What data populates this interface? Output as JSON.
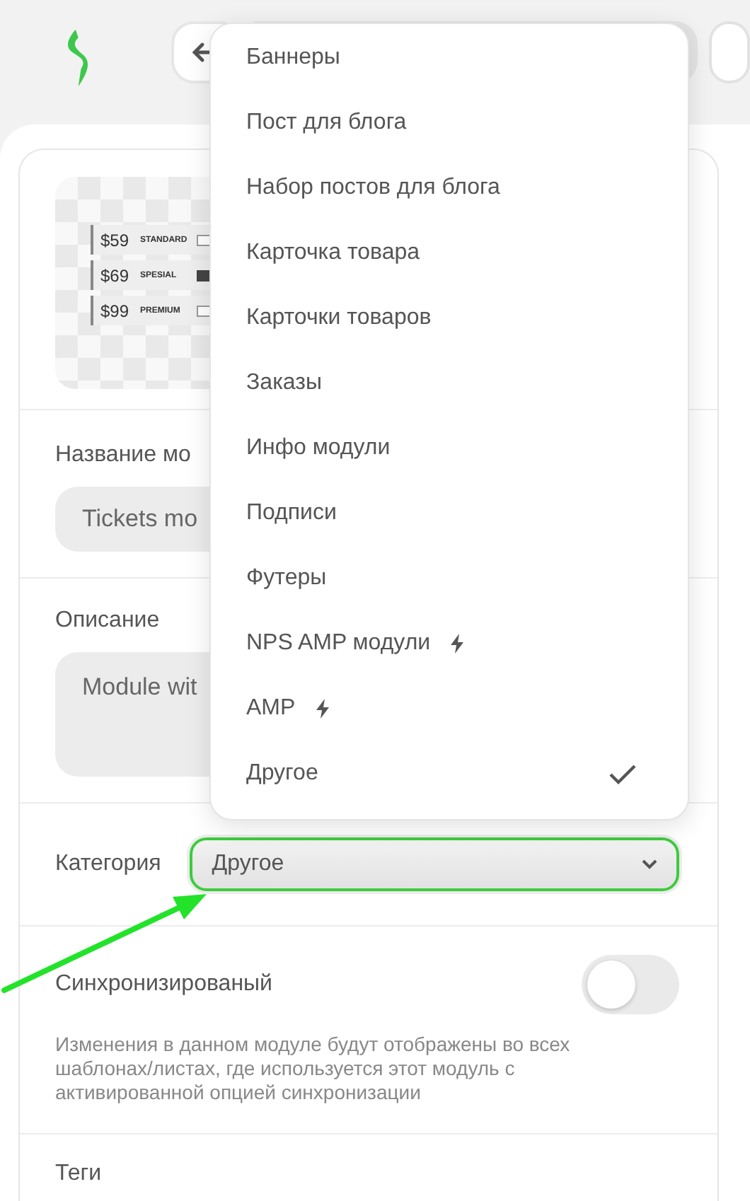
{
  "module_card": {
    "thumbnail": {
      "tickets": [
        {
          "price": "$59",
          "plan": "STANDARD",
          "highlighted": false
        },
        {
          "price": "$69",
          "plan": "SPESIAL",
          "highlighted": true
        },
        {
          "price": "$99",
          "plan": "PREMIUM",
          "highlighted": false
        }
      ]
    },
    "name_field": {
      "label": "Название мо",
      "value": "Tickets mo"
    },
    "description_field": {
      "label": "Описание",
      "value": "Module wit"
    },
    "category": {
      "label": "Категория",
      "value": "Другое",
      "focused": true
    },
    "sync": {
      "label": "Синхронизированый",
      "on": false,
      "hint": "Изменения в данном модуле будут отображены во всех шаблонах/листах, где используется этот модуль с активированной опцией синхронизации"
    },
    "tags": {
      "label": "Теги"
    }
  },
  "category_menu": {
    "items": [
      {
        "label": "Баннеры",
        "amp": false,
        "selected": false
      },
      {
        "label": "Пост для блога",
        "amp": false,
        "selected": false
      },
      {
        "label": "Набор постов для блога",
        "amp": false,
        "selected": false
      },
      {
        "label": "Карточка товара",
        "amp": false,
        "selected": false
      },
      {
        "label": "Карточки товаров",
        "amp": false,
        "selected": false
      },
      {
        "label": "Заказы",
        "amp": false,
        "selected": false
      },
      {
        "label": "Инфо модули",
        "amp": false,
        "selected": false
      },
      {
        "label": "Подписи",
        "amp": false,
        "selected": false
      },
      {
        "label": "Футеры",
        "amp": false,
        "selected": false
      },
      {
        "label": "NPS AMP модули",
        "amp": true,
        "selected": false
      },
      {
        "label": "AMP",
        "amp": true,
        "selected": false
      },
      {
        "label": "Другое",
        "amp": false,
        "selected": true
      }
    ]
  }
}
